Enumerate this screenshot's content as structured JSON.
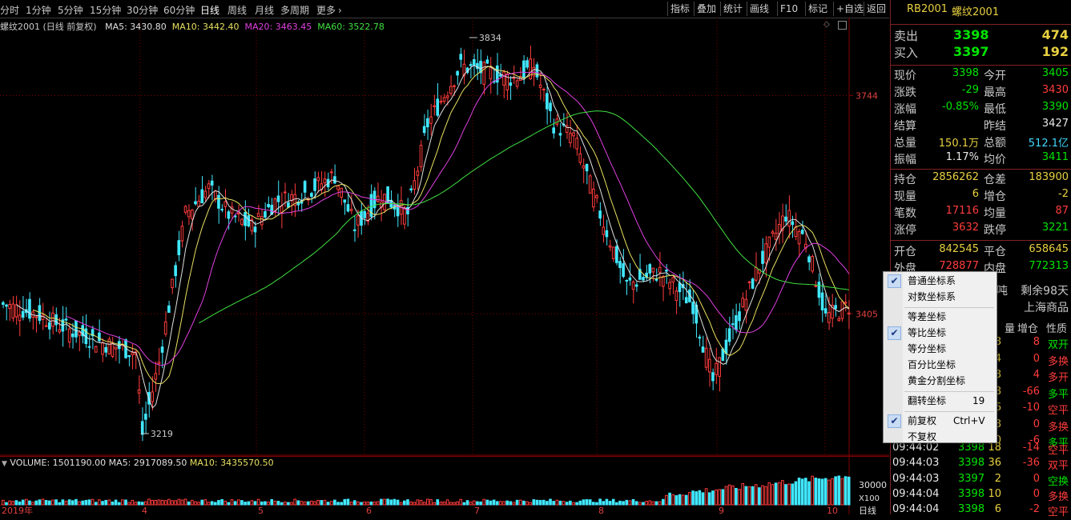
{
  "toolbar": {
    "periods": [
      "分时",
      "1分钟",
      "5分钟",
      "15分钟",
      "30分钟",
      "60分钟",
      "日线",
      "周线",
      "月线",
      "多周期",
      "更多"
    ],
    "active_period": "日线",
    "right_buttons": [
      "指标",
      "叠加",
      "统计",
      "画线",
      "F10",
      "标记",
      "+自选",
      "返回"
    ]
  },
  "main_chart": {
    "title": "螺纹2001 (日线 前复权)",
    "ma_labels": [
      {
        "text": "MA5: 3430.80",
        "color": "#e0e0e0"
      },
      {
        "text": "MA10: 3442.40",
        "color": "#e8e060"
      },
      {
        "text": "MA20: 3463.45",
        "color": "#e040e0"
      },
      {
        "text": "MA60: 3522.78",
        "color": "#40e040"
      }
    ],
    "price_axis": [
      {
        "value": 3744,
        "label": "3744"
      },
      {
        "value": 3405,
        "label": "3405"
      }
    ],
    "high_marker": "3834",
    "low_marker": "3219",
    "high_value": 3834,
    "low_value": 3219
  },
  "volume_chart": {
    "label": "VOLUME: 1501190.00",
    "ma5": "MA5: 2917089.50",
    "ma10": "MA10: 3435570.50",
    "axis_label": "30000",
    "unit": "X100"
  },
  "date_axis": {
    "labels": [
      "2019年",
      "4",
      "5",
      "6",
      "7",
      "8",
      "9",
      "10"
    ],
    "period_button": "日线"
  },
  "colors": {
    "up": "#ff3c3c",
    "down": "#40e8ff",
    "ma5": "#e0e0e0",
    "ma10": "#e8e060",
    "ma20": "#e040e0",
    "ma60": "#40e040",
    "grid": "#800000"
  },
  "panel": {
    "symbol": "RB2001",
    "name": "螺纹2001",
    "sell": {
      "label": "卖出",
      "price": "3398",
      "volume": "474"
    },
    "buy": {
      "label": "买入",
      "price": "3397",
      "volume": "192"
    },
    "quote_rows": [
      {
        "l1": "现价",
        "v1": "3398",
        "c1": "green",
        "l2": "今开",
        "v2": "3405",
        "c2": "green"
      },
      {
        "l1": "涨跌",
        "v1": "-29",
        "c1": "green",
        "l2": "最高",
        "v2": "3430",
        "c2": "red"
      },
      {
        "l1": "涨幅",
        "v1": "-0.85%",
        "c1": "green",
        "l2": "最低",
        "v2": "3390",
        "c2": "green"
      },
      {
        "l1": "结算",
        "v1": "",
        "c1": "white",
        "l2": "昨结",
        "v2": "3427",
        "c2": "white"
      },
      {
        "l1": "总量",
        "v1": "150.1万",
        "c1": "yellow",
        "l2": "总额",
        "v2": "512.1亿",
        "c2": "cyan"
      },
      {
        "l1": "振幅",
        "v1": "1.17%",
        "c1": "white",
        "l2": "均价",
        "v2": "3411",
        "c2": "green"
      }
    ],
    "position_rows": [
      {
        "l1": "持仓",
        "v1": "2856262",
        "c1": "yellow",
        "l2": "仓差",
        "v2": "183900",
        "c2": "yellow"
      },
      {
        "l1": "现量",
        "v1": "6",
        "c1": "yellow",
        "l2": "增仓",
        "v2": "-2",
        "c2": "yellow"
      },
      {
        "l1": "笔数",
        "v1": "17116",
        "c1": "red",
        "l2": "均量",
        "v2": "87",
        "c2": "red"
      },
      {
        "l1": "涨停",
        "v1": "3632",
        "c1": "red",
        "l2": "跌停",
        "v2": "3221",
        "c2": "green"
      }
    ],
    "open_rows": [
      {
        "l1": "开仓",
        "v1": "842545",
        "c1": "yellow",
        "l2": "平仓",
        "v2": "658645",
        "c2": "yellow"
      },
      {
        "l1": "外盘",
        "v1": "728877",
        "c1": "red",
        "l2": "内盘",
        "v2": "772313",
        "c2": "green"
      }
    ],
    "info_line1": {
      "a": "吨",
      "b": "剩余98天"
    },
    "info_line2": "上海商品",
    "tick_headers": [
      "量",
      "增仓",
      "性质"
    ],
    "ticks_hidden": [
      {
        "vol": "8",
        "chg": "8",
        "nature": "双开",
        "nc": "green"
      },
      {
        "vol": "4",
        "chg": "0",
        "nature": "多换",
        "nc": "red"
      },
      {
        "vol": "8",
        "chg": "4",
        "nature": "多开",
        "nc": "red"
      },
      {
        "vol": "178",
        "chg": "-66",
        "nature": "多平",
        "nc": "green"
      },
      {
        "vol": "26",
        "chg": "-10",
        "nature": "空平",
        "nc": "red"
      },
      {
        "vol": "18",
        "chg": "0",
        "nature": "多换",
        "nc": "red"
      },
      {
        "vol": "40",
        "chg": "-6",
        "nature": "多平",
        "nc": "green"
      }
    ],
    "ticks": [
      {
        "time": "09:44:02",
        "price": "3398",
        "vol": "18",
        "chg": "-14",
        "nature": "空平",
        "nc": "red"
      },
      {
        "time": "09:44:03",
        "price": "3398",
        "vol": "36",
        "chg": "-36",
        "nature": "双平",
        "nc": "red"
      },
      {
        "time": "09:44:03",
        "price": "3397",
        "vol": "2",
        "chg": "0",
        "nature": "空换",
        "nc": "green"
      },
      {
        "time": "09:44:04",
        "price": "3398",
        "vol": "10",
        "chg": "0",
        "nature": "多换",
        "nc": "red"
      },
      {
        "time": "09:44:04",
        "price": "3398",
        "vol": "6",
        "chg": "-2",
        "nature": "空平",
        "nc": "red"
      }
    ]
  },
  "context_menu": {
    "items": [
      {
        "label": "普通坐标系",
        "checked": true
      },
      {
        "label": "对数坐标系",
        "checked": false
      },
      {
        "sep": true
      },
      {
        "label": "等差坐标",
        "checked": false
      },
      {
        "label": "等比坐标",
        "checked": true
      },
      {
        "label": "等分坐标",
        "checked": false
      },
      {
        "label": "百分比坐标",
        "checked": false
      },
      {
        "label": "黄金分割坐标",
        "checked": false
      },
      {
        "sep": true
      },
      {
        "label": "翻转坐标",
        "checked": false,
        "shortcut": "19"
      },
      {
        "sep": true
      },
      {
        "label": "前复权",
        "checked": true,
        "shortcut": "Ctrl+V"
      },
      {
        "label": "不复权",
        "checked": false
      }
    ]
  }
}
